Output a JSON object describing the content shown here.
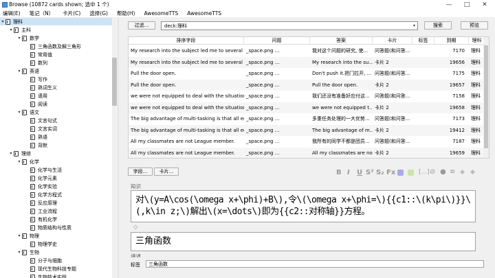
{
  "window": {
    "title": "Browse (10872 cards shown; 选中 1 个)",
    "min": "—",
    "max": "□",
    "close": "✕"
  },
  "menu": [
    "编辑(E)",
    "笔记（N）",
    "卡片(C)",
    "选择(G)",
    "帮助(H)",
    "AwesomeTTS",
    "AwesomeTTS"
  ],
  "sidebar": {
    "items": [
      {
        "label": "理科",
        "level": 0,
        "arrow": "▾",
        "selected": true
      },
      {
        "label": "主科",
        "level": 1,
        "arrow": "▾"
      },
      {
        "label": "数学",
        "level": 2,
        "arrow": "▾"
      },
      {
        "label": "三角函数及解三角形",
        "level": 3,
        "arrow": ""
      },
      {
        "label": "常用值",
        "level": 3,
        "arrow": ""
      },
      {
        "label": "数列",
        "level": 3,
        "arrow": ""
      },
      {
        "label": "英语",
        "level": 2,
        "arrow": "▾"
      },
      {
        "label": "写作",
        "level": 3,
        "arrow": ""
      },
      {
        "label": "熟词生义",
        "level": 3,
        "arrow": ""
      },
      {
        "label": "语用",
        "level": 3,
        "arrow": ""
      },
      {
        "label": "阅读",
        "level": 3,
        "arrow": ""
      },
      {
        "label": "语文",
        "level": 2,
        "arrow": "▾"
      },
      {
        "label": "文言句式",
        "level": 3,
        "arrow": ""
      },
      {
        "label": "文言实词",
        "level": 3,
        "arrow": ""
      },
      {
        "label": "熟语",
        "level": 3,
        "arrow": ""
      },
      {
        "label": "背默",
        "level": 3,
        "arrow": ""
      },
      {
        "label": "理综",
        "level": 1,
        "arrow": "▾"
      },
      {
        "label": "化学",
        "level": 2,
        "arrow": "▾"
      },
      {
        "label": "化学与生活",
        "level": 3,
        "arrow": ""
      },
      {
        "label": "化学元素",
        "level": 3,
        "arrow": ""
      },
      {
        "label": "化学实验",
        "level": 3,
        "arrow": ""
      },
      {
        "label": "化学方程式",
        "level": 3,
        "arrow": ""
      },
      {
        "label": "反应原理",
        "level": 3,
        "arrow": ""
      },
      {
        "label": "工业流程",
        "level": 3,
        "arrow": ""
      },
      {
        "label": "有机化学",
        "level": 3,
        "arrow": ""
      },
      {
        "label": "物质结构与性质",
        "level": 3,
        "arrow": ""
      },
      {
        "label": "物理",
        "level": 2,
        "arrow": "▾"
      },
      {
        "label": "物理学史",
        "level": 3,
        "arrow": ""
      },
      {
        "label": "生物",
        "level": 2,
        "arrow": "▾"
      },
      {
        "label": "分子与细胞",
        "level": 3,
        "arrow": ""
      },
      {
        "label": "现代生物科技专题",
        "level": 3,
        "arrow": ""
      },
      {
        "label": "生物技术实践",
        "level": 3,
        "arrow": ""
      }
    ]
  },
  "toolbar": {
    "filter_label": "过滤...",
    "search_value": "deck:理科",
    "search_button": "搜索",
    "preview_button": "预览"
  },
  "table": {
    "columns": [
      "排序字段",
      "问题",
      "答案",
      "卡片",
      "标签",
      "到期",
      "理科"
    ],
    "rows": [
      [
        "My research into the subject led me to several c...",
        "_space.png ...",
        "我对这个问题的研究, 使...",
        "问答题(和问答...",
        "",
        "7170",
        "理科"
      ],
      [
        "My research into the subject led me to several c...",
        "_space.png ...",
        "My research into the su...",
        "卡片 2",
        "",
        "19656",
        "理科"
      ],
      [
        "Pull the door open.",
        "_space.png ...",
        "Don't push it.把门拉开, ...",
        "问答题(和问答...",
        "",
        "7175",
        "理科"
      ],
      [
        "Pull the door open.",
        "_space.png ...",
        "Pull the door open.",
        "卡片 2",
        "",
        "19657",
        "理科"
      ],
      [
        "we were not equipped to deal with the situation.",
        "_space.png ...",
        "我们还没有准备好应付这...",
        "问答题(和问答...",
        "",
        "7158",
        "理科"
      ],
      [
        "we were not equipped to deal with the situation.",
        "_space.png ...",
        "we were not equipped t...",
        "卡片 2",
        "",
        "19658",
        "理科"
      ],
      [
        "The big advantage of multi-tasking is that all eq...",
        "_space.png ...",
        "多重任务处理的一大优势...",
        "问答题(和问答...",
        "",
        "7173",
        "理科"
      ],
      [
        "The big advantage of multi-tasking is that all eq...",
        "_space.png ...",
        "The big advantage of m...",
        "卡片 2",
        "",
        "19412",
        "理科"
      ],
      [
        "All my classmates are not League member.",
        "_space.png ...",
        "我所有的同学不都是团员...",
        "问答题(和问答...",
        "",
        "7187",
        "理科"
      ],
      [
        "All my classmates are not League member.",
        "_space.png ...",
        "All my classmates are no...",
        "卡片 2",
        "",
        "19659",
        "理科"
      ]
    ]
  },
  "editor": {
    "fields_button": "字段...",
    "cards_button": "卡片...",
    "field1_label": "知识",
    "field1_value": "对\\(y=A\\cos(\\omega x+\\phi)+B\\),令\\(\\omega x+\\phi=\\){{c1::\\(k\\pi\\)}}\\(,k\\in z;\\)解出\\(x=\\dots\\)即为{{c2::对称轴}}方程。",
    "field2_value": "三角函数",
    "field3_label": "讲述",
    "tags_label": "标签",
    "tags_value": "三角函数",
    "format_icons": [
      "B",
      "I",
      "U",
      "S²",
      "S₂",
      "Fx"
    ]
  }
}
